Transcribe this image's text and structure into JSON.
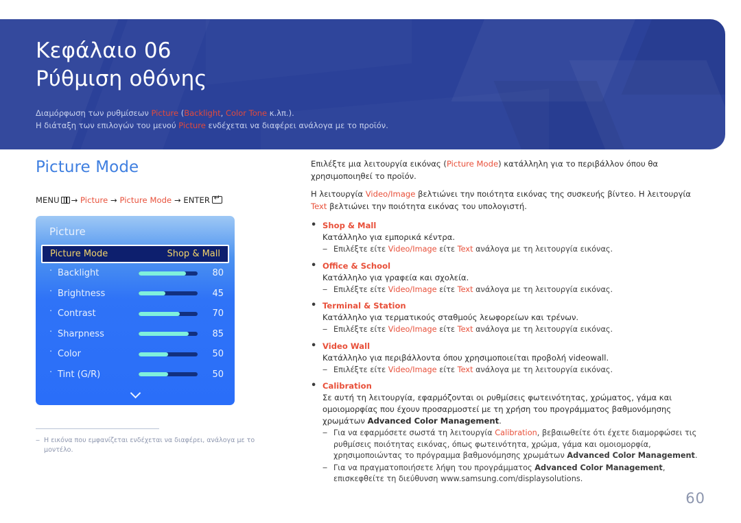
{
  "banner": {
    "chapter": "Κεφάλαιο 06",
    "chapter_title": "Ρύθμιση οθόνης",
    "sub_line1_a": "Διαμόρφωση των ρυθμίσεων ",
    "sub_line1_hl1": "Picture",
    "sub_line1_b": " (",
    "sub_line1_hl2": "Backlight",
    "sub_line1_c": ", ",
    "sub_line1_hl3": "Color Tone",
    "sub_line1_d": " κ.λπ.).",
    "sub_line2_a": "Η διάταξη των επιλογών του μενού ",
    "sub_line2_hl1": "Picture",
    "sub_line2_b": " ενδέχεται να διαφέρει ανάλογα με το προϊόν.",
    "bg_color": "#2b4199"
  },
  "section": {
    "title": "Picture Mode",
    "title_color": "#3f7fe0"
  },
  "menu_path": {
    "menu_label": "MENU",
    "arrow": "→",
    "step1": "Picture",
    "step2": "Picture Mode",
    "enter_label": "ENTER"
  },
  "osd": {
    "title": "Picture",
    "selected": {
      "label": "Picture Mode",
      "value": "Shop & Mall"
    },
    "rows": [
      {
        "label": "Backlight",
        "value": "80",
        "pct": 80
      },
      {
        "label": "Brightness",
        "value": "45",
        "pct": 45
      },
      {
        "label": "Contrast",
        "value": "70",
        "pct": 70
      },
      {
        "label": "Sharpness",
        "value": "85",
        "pct": 85
      },
      {
        "label": "Color",
        "value": "50",
        "pct": 50
      },
      {
        "label": "Tint (G/R)",
        "value": "50",
        "pct": 50
      }
    ],
    "more_icon": "chevron-down-icon",
    "slider_fill_color": "#7ff0dc",
    "slider_track_color": "#12307f",
    "highlight_bg": "#0d1f6e",
    "highlight_text_color": "#f2d36a"
  },
  "footnote": {
    "dash": "‒",
    "text": "Η εικόνα που εμφανίζεται ενδέχεται να διαφέρει, ανάλογα με το μοντέλο."
  },
  "body": {
    "intro1_a": "Επιλέξτε μια λειτουργία εικόνας (",
    "intro1_hl": "Picture Mode",
    "intro1_b": ") κατάλληλη για το περιβάλλον όπου θα χρησιμοποιηθεί το προϊόν.",
    "intro2_a": "Η λειτουργία ",
    "intro2_hl1": "Video/Image",
    "intro2_b": " βελτιώνει την ποιότητα εικόνας της συσκευής βίντεο. Η λειτουργία ",
    "intro2_hl2": "Text",
    "intro2_c": " βελτιώνει την ποιότητα εικόνας του υπολογιστή.",
    "sub_prefix": "Επιλέξτε είτε ",
    "sub_hl1": "Video/Image",
    "sub_mid": " είτε ",
    "sub_hl2": "Text",
    "sub_suffix": " ανάλογα με τη λειτουργία εικόνας.",
    "items": [
      {
        "name": "Shop & Mall",
        "desc": "Κατάλληλο για εμπορικά κέντρα."
      },
      {
        "name": "Office & School",
        "desc": "Κατάλληλο για γραφεία και σχολεία."
      },
      {
        "name": "Terminal & Station",
        "desc": "Κατάλληλο για τερματικούς σταθμούς λεωφορείων και τρένων."
      },
      {
        "name": "Video Wall",
        "desc": "Κατάλληλο για περιβάλλοντα όπου χρησιμοποιείται προβολή videowall."
      },
      {
        "name": "Calibration",
        "desc": ""
      }
    ],
    "calibration_desc_a": "Σε αυτή τη λειτουργία, εφαρμόζονται οι ρυθμίσεις φωτεινότητας, χρώματος, γάμα και ομοιομορφίας που έχουν προσαρμοστεί με τη χρήση του προγράμματος βαθμονόμησης χρωμάτων ",
    "calibration_desc_bold": "Advanced Color Management",
    "calibration_desc_b": ".",
    "cal_sub1_a": "Για να εφαρμόσετε σωστά τη λειτουργία ",
    "cal_sub1_hl": "Calibration",
    "cal_sub1_b": ", βεβαιωθείτε ότι έχετε διαμορφώσει τις ρυθμίσεις ποιότητας εικόνας, όπως φωτεινότητα, χρώμα, γάμα και ομοιομορφία, χρησιμοποιώντας το πρόγραμμα βαθμονόμησης χρωμάτων ",
    "cal_sub1_bold": "Advanced Color Management",
    "cal_sub1_c": ".",
    "cal_sub2_a": "Για να πραγματοποιήσετε λήψη του προγράμματος ",
    "cal_sub2_bold": "Advanced Color Management",
    "cal_sub2_b": ", επισκεφθείτε τη διεύθυνση www.samsung.com/displaysolutions."
  },
  "page_number": "60"
}
